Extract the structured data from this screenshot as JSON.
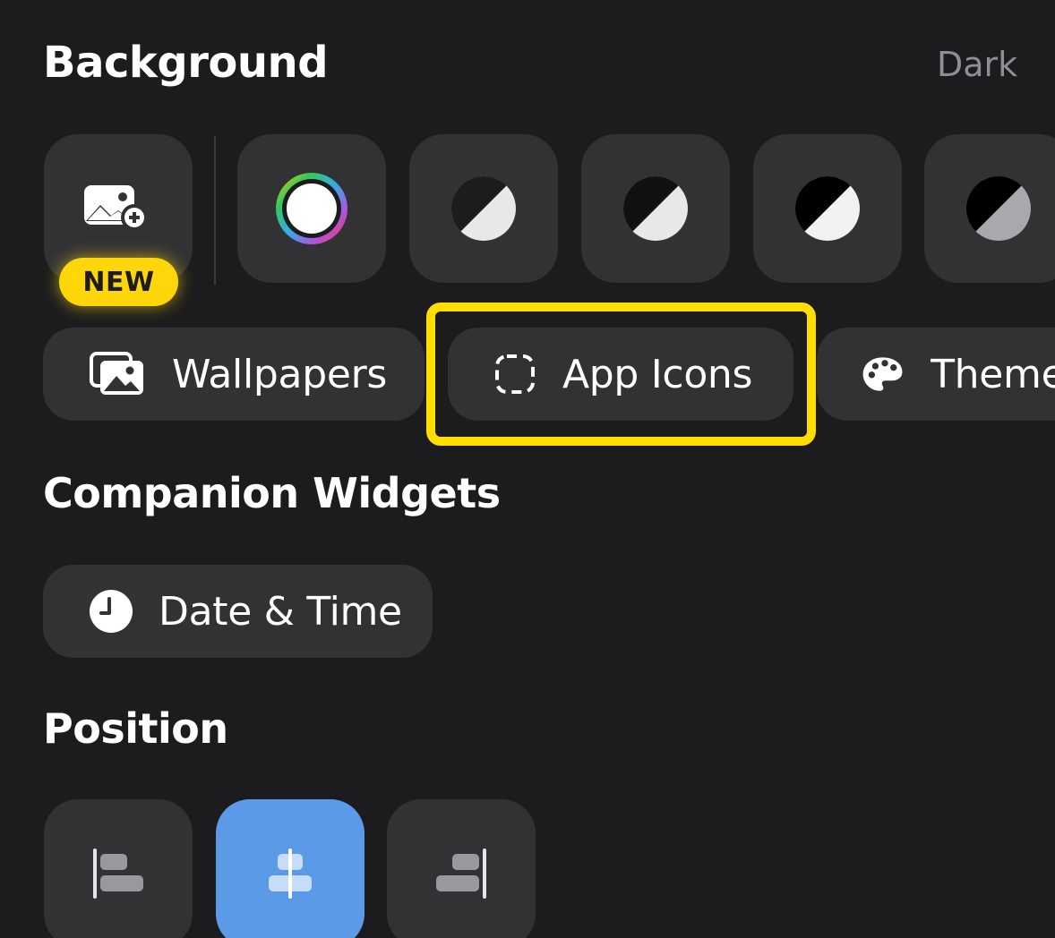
{
  "background": {
    "title": "Background",
    "mode_label": "Dark",
    "new_badge": "NEW",
    "tiles": [
      {
        "icon": "add-photo-icon"
      },
      {
        "icon": "color-wheel-icon"
      },
      {
        "icon": "contrast-icon"
      },
      {
        "icon": "contrast-icon"
      },
      {
        "icon": "contrast-icon"
      },
      {
        "icon": "contrast-icon"
      }
    ],
    "categories": {
      "wallpapers": {
        "label": "Wallpapers",
        "icon": "wallpapers-icon"
      },
      "app_icons": {
        "label": "App Icons",
        "icon": "dashed-square-icon"
      },
      "themes": {
        "label": "Themes",
        "icon": "palette-icon"
      }
    }
  },
  "companion_widgets": {
    "title": "Companion Widgets",
    "date_time": {
      "label": "Date & Time",
      "icon": "clock-icon"
    }
  },
  "position": {
    "title": "Position",
    "options": [
      {
        "name": "align-left",
        "icon": "align-left-icon",
        "selected": false
      },
      {
        "name": "align-center",
        "icon": "align-center-icon",
        "selected": true
      },
      {
        "name": "align-right",
        "icon": "align-right-icon",
        "selected": false
      }
    ]
  },
  "colors": {
    "background": "#1c1c1e",
    "tile": "#323235",
    "accent_selected": "#5a9ae6",
    "badge": "#ffd60a",
    "highlight": "#ffdd00",
    "muted_text": "#8e8e93"
  }
}
